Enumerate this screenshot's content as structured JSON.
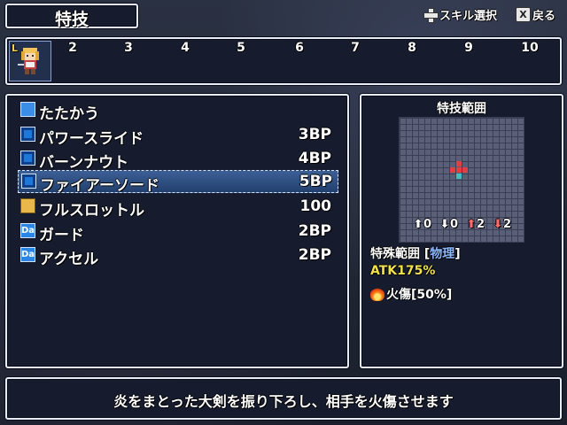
{
  "header": {
    "title": "特技",
    "hint_skill_select": "スキル選択",
    "hint_back": "戻る",
    "hint_back_button": "X"
  },
  "party": {
    "level_badge": "L",
    "slots": [
      "2",
      "3",
      "4",
      "5",
      "6",
      "7",
      "8",
      "9",
      "10"
    ]
  },
  "skills": [
    {
      "name": "たたかう",
      "cost": "",
      "icon": "sword-icon",
      "selected": false
    },
    {
      "name": "パワースライド",
      "cost": "3BP",
      "icon": "skill-square-icon",
      "selected": false
    },
    {
      "name": "バーンナウト",
      "cost": "4BP",
      "icon": "skill-square-icon",
      "selected": false
    },
    {
      "name": "ファイアーソード",
      "cost": "5BP",
      "icon": "skill-square-icon",
      "selected": true
    },
    {
      "name": "フルスロットル",
      "cost": "100",
      "icon": "slot-icon",
      "selected": false
    },
    {
      "name": "ガード",
      "cost": "2BP",
      "icon": "da-icon",
      "icon_text": "Da",
      "selected": false
    },
    {
      "name": "アクセル",
      "cost": "2BP",
      "icon": "da-icon",
      "icon_text": "Da",
      "selected": false
    }
  ],
  "range_panel": {
    "title": "特技範囲",
    "modifiers": [
      "0",
      "0",
      "2",
      "2"
    ],
    "range_type_label": "特殊範囲 [",
    "range_type_value": "物理",
    "range_type_close": "]",
    "atk": "ATK175%",
    "status_effect": "火傷[50%]"
  },
  "message": "炎をまとった大剣を振り下ろし、相手を火傷させます",
  "colors": {
    "frame": "#e8ecf6",
    "panel": "#161b2e",
    "highlight": "#3c5f96",
    "atk": "#f2e24a",
    "range_cell": "#e04040",
    "center_cell": "#40c0c0"
  }
}
